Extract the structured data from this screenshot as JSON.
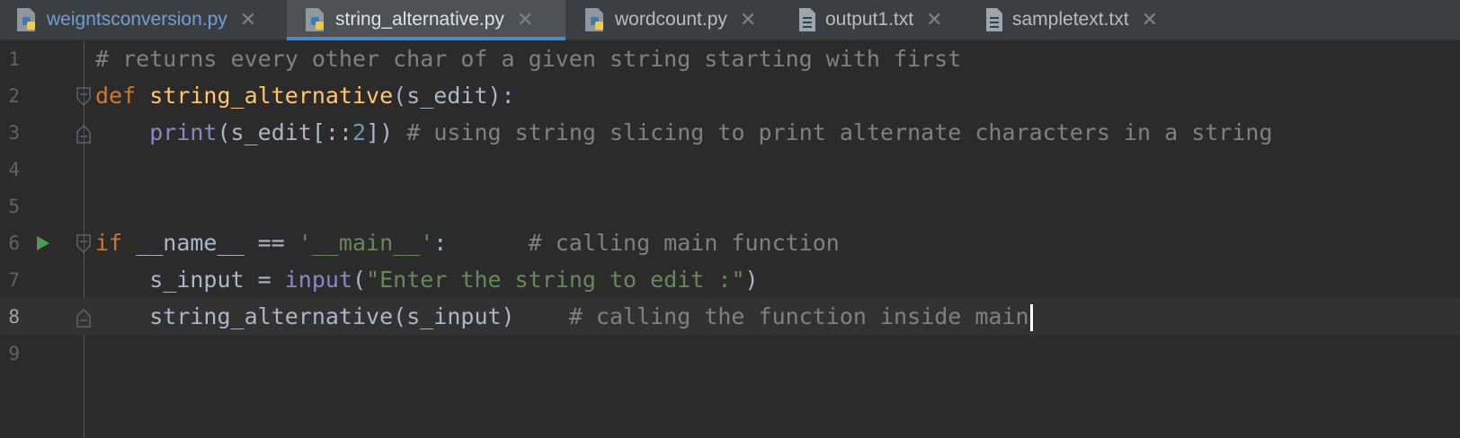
{
  "tabs": [
    {
      "label": "weigntsconversion.py",
      "icon": "python-file-icon",
      "active": false
    },
    {
      "label": "string_alternative.py",
      "icon": "python-file-icon",
      "active": true
    },
    {
      "label": "wordcount.py",
      "icon": "python-file-icon",
      "active": false
    },
    {
      "label": "output1.txt",
      "icon": "text-file-icon",
      "active": false
    },
    {
      "label": "sampletext.txt",
      "icon": "text-file-icon",
      "active": false
    }
  ],
  "close_glyph": "✕",
  "line_numbers": [
    "1",
    "2",
    "3",
    "4",
    "5",
    "6",
    "7",
    "8",
    "9"
  ],
  "code": {
    "l1": {
      "comment": "# returns every other char of a given string starting with first"
    },
    "l2": {
      "kw": "def",
      "sp": " ",
      "fn": "string_alternative",
      "rest": "(s_edit):"
    },
    "l3": {
      "indent": "    ",
      "builtin": "print",
      "a": "(s_edit[::",
      "num": "2",
      "b": "]) ",
      "comment": "# using string slicing to print alternate characters in a string"
    },
    "l6": {
      "kw": "if",
      "a": " __name__ == ",
      "str": "'__main__'",
      "b": ":      ",
      "comment": "# calling main function"
    },
    "l7": {
      "indent": "    ",
      "a": "s_input = ",
      "builtin": "input",
      "b": "(",
      "str": "\"Enter the string to edit :\"",
      "c": ")"
    },
    "l8": {
      "indent": "    ",
      "a": "string_alternative(s_input)    ",
      "comment": "# calling the function inside main"
    }
  },
  "colors": {
    "background": "#2b2b2b",
    "keyword": "#cc7832",
    "function": "#ffc66d",
    "builtin": "#8888c6",
    "number": "#6897bb",
    "string": "#6a8759",
    "comment": "#808080",
    "active_tab_underline": "#4a88c7",
    "run_icon": "#499c54"
  },
  "current_line": "8",
  "run_icon": "run-arrow-icon",
  "fold_icon": "fold-marker-icon"
}
